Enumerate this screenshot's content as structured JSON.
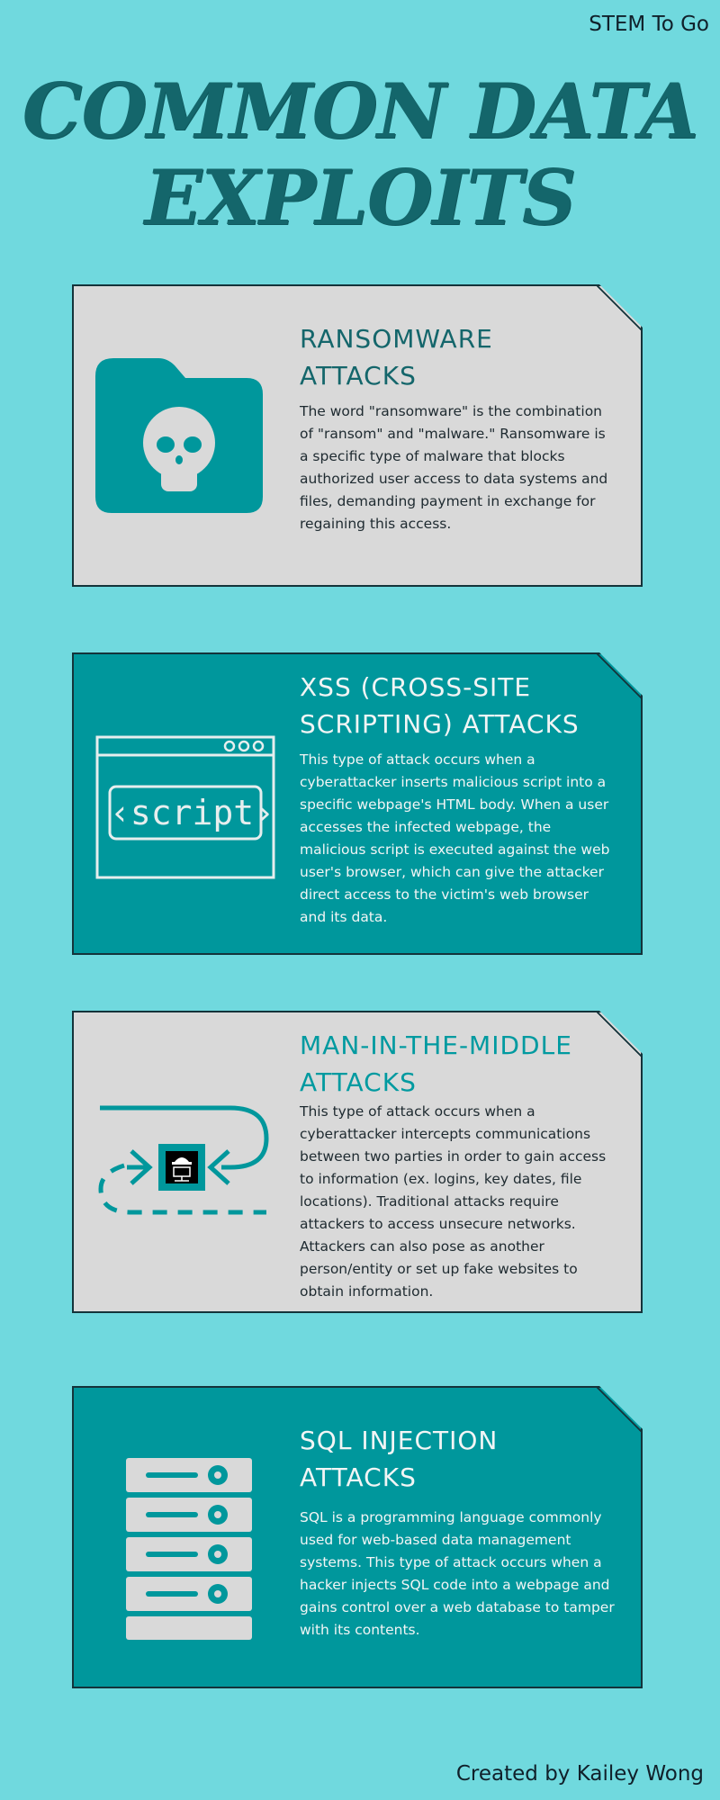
{
  "brand": "STEM To Go",
  "title": "COMMON DATA EXPLOITS",
  "cards": [
    {
      "title": "RANSOMWARE ATTACKS",
      "body": "The word \"ransomware\" is the combination of \"ransom\" and \"malware.\" Ransomware is a specific type of malware that blocks authorized user access to data systems and files, demanding payment in exchange for regaining this access.",
      "icon": "skull-folder-icon"
    },
    {
      "title": "XSS (CROSS-SITE SCRIPTING) ATTACKS",
      "body": "This type of attack occurs when a cyberattacker inserts malicious script into a specific webpage's HTML body. When a user accesses the infected webpage, the malicious script is executed against the web user's browser, which can give the attacker direct access to the victim's web browser and its data.",
      "icon": "browser-script-icon",
      "icon_label": "‹script›"
    },
    {
      "title": "MAN-IN-THE-MIDDLE ATTACKS",
      "body": "This type of attack occurs when a cyberattacker intercepts communications between two parties in order to gain access to information (ex. logins, key dates, file locations). Traditional attacks require attackers to access unsecure networks. Attackers can also pose as another person/entity or set up fake websites to obtain information.",
      "icon": "interception-icon"
    },
    {
      "title": "SQL INJECTION ATTACKS",
      "body": "SQL is a programming language commonly used for web-based data management systems. This type of attack occurs when a hacker injects SQL code into a webpage and gains control over a web database to tamper with its contents.",
      "icon": "server-stack-icon"
    }
  ],
  "footer": "Created by Kailey Wong",
  "colors": {
    "background": "#70d9de",
    "title": "#14666b",
    "card_light": "#d9d9d9",
    "card_teal": "#00979c",
    "shadow": "#0b323a"
  }
}
